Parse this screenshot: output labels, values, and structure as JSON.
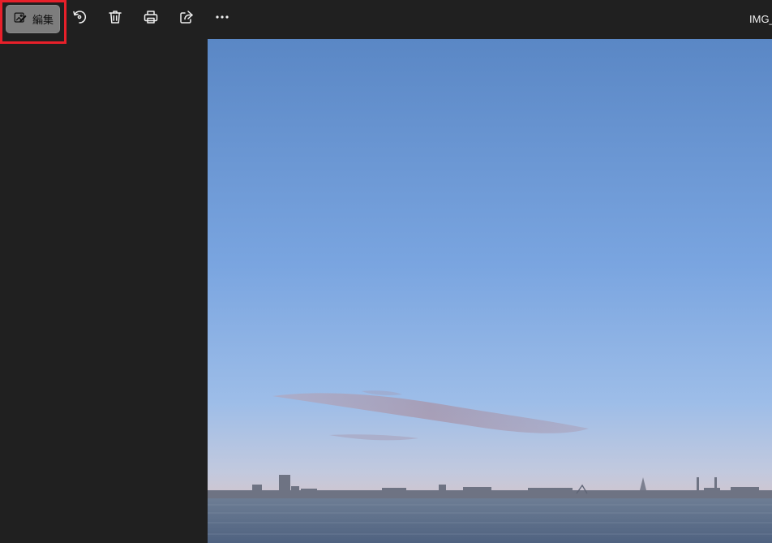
{
  "toolbar": {
    "edit_label": "編集",
    "filename": "IMG_"
  },
  "icons": {
    "edit": "edit-image-icon",
    "rotate": "rotate-icon",
    "delete": "trash-icon",
    "print": "print-icon",
    "share": "share-icon",
    "more": "more-icon"
  },
  "colors": {
    "app_background": "#202020",
    "edit_button": "#7d7d7d",
    "highlight_border": "#e8202a",
    "icon": "#f0f0f0"
  }
}
